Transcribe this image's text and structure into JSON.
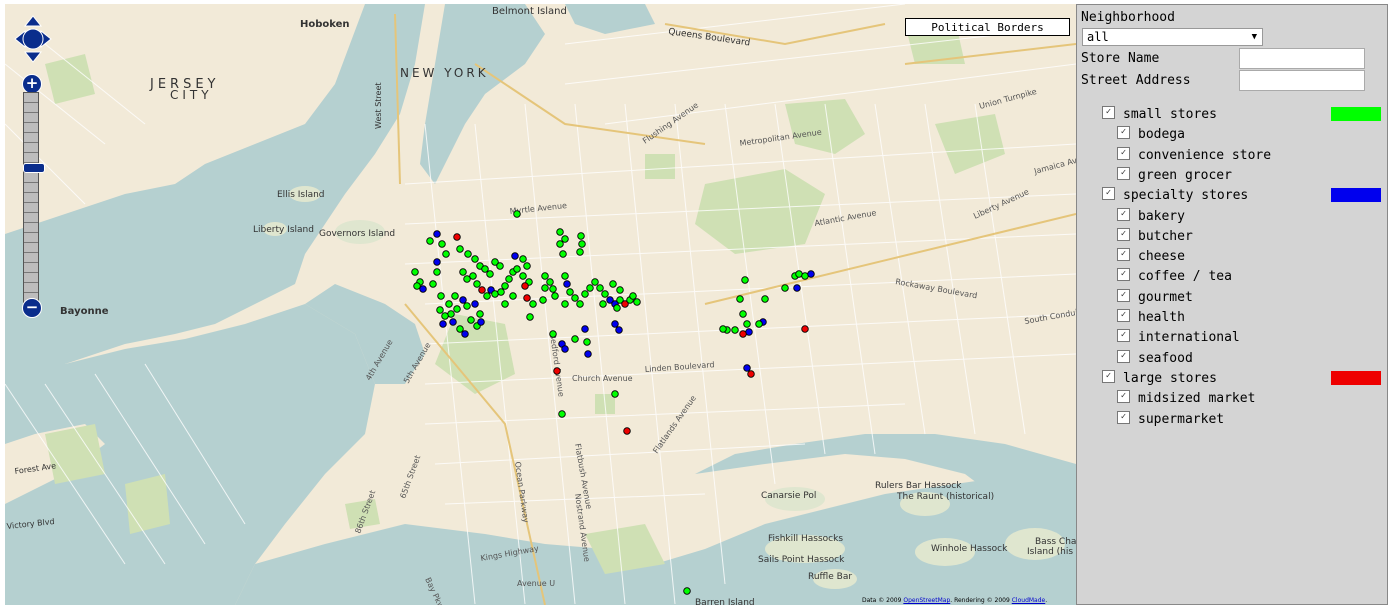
{
  "map": {
    "political_borders_label": "Political Borders",
    "attribution": {
      "prefix": "Data © 2009",
      "osm": "OpenStreetMap",
      "mid": ". Rendering © 2009",
      "cloudmade": "CloudMade",
      "suffix": "."
    },
    "zoom_in": "+",
    "zoom_out": "−",
    "places": [
      "Hoboken",
      "Belmont Island",
      "Queens Boulevard",
      "NEW YORK",
      "JERSEY",
      "CITY",
      "West Street",
      "Ellis Island",
      "Liberty Island",
      "Governors Island",
      "Bayonne",
      "Canarsie Pol",
      "Rulers Bar Hassock",
      "The Raunt (historical)",
      "Fishkill Hassocks",
      "Winhole Hassock",
      "Bass Cha",
      "Island (his",
      "Sails Point Hassock",
      "Ruffle Bar",
      "Barren Island",
      "Victory Blvd",
      "Forest Ave"
    ],
    "roads": [
      "Myrtle Avenue",
      "Metropolitan Avenue",
      "Flushing Avenue",
      "Jamaica Avenue",
      "Atlantic Avenue",
      "Rockaway Boulevard",
      "Church Avenue",
      "Linden Boulevard",
      "Flatlands Avenue",
      "Kings Highway",
      "Avenue U",
      "Ocean Parkway",
      "Nostrand Avenue",
      "Union Turnpike",
      "Liberty Avenue",
      "South Conduit",
      "Flatbush Avenue",
      "4th Avenue",
      "5th Avenue",
      "65th Street",
      "86th Street",
      "Bay Pkwy",
      "Bedford Avenue"
    ],
    "store_colors": {
      "small": "#00ff00",
      "specialty": "#0000ee",
      "large": "#ee0000"
    }
  },
  "panel": {
    "neighborhood_label": "Neighborhood",
    "neighborhood_value": "all",
    "store_name_label": "Store Name",
    "street_address_label": "Street Address",
    "store_name_value": "",
    "street_address_value": "",
    "groups": [
      {
        "label": "small stores",
        "checked": true,
        "color": "#00ff00",
        "items": [
          "bodega",
          "convenience store",
          "green grocer"
        ]
      },
      {
        "label": "specialty stores",
        "checked": true,
        "color": "#0000ee",
        "items": [
          "bakery",
          "butcher",
          "cheese",
          "coffee / tea",
          "gourmet",
          "health",
          "international",
          "seafood"
        ]
      },
      {
        "label": "large stores",
        "checked": true,
        "color": "#ee0000",
        "items": [
          "midsized market",
          "supermarket"
        ]
      }
    ]
  }
}
